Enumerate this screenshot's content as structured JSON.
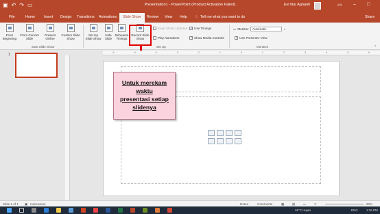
{
  "window": {
    "title": "Presentation1 - PowerPoint (Product Activation Failed)",
    "user": "Evi Nur Agnanti",
    "qat_icons": [
      "save-icon",
      "undo-icon",
      "redo-icon",
      "present-icon"
    ]
  },
  "menu": {
    "tabs": [
      "File",
      "Home",
      "Insert",
      "Design",
      "Transitions",
      "Animations",
      "Slide Show",
      "Review",
      "View",
      "Help"
    ],
    "active_tab": "Slide Show",
    "tell_me": "Tell me what you want to do",
    "share": "Share"
  },
  "ribbon": {
    "start_group": {
      "label": "Start Slide Show",
      "buttons": [
        "From Beginning",
        "From Current Slide",
        "Present Online",
        "Custom Slide Show"
      ]
    },
    "setup_group": {
      "label": "Set Up",
      "buttons": [
        "Set Up Slide Show",
        "Hide Slide",
        "Rehearse Timings",
        "Record Slide Show"
      ],
      "checks": [
        {
          "label": "Keep Slides Updated",
          "checked": false
        },
        {
          "label": "Use Timings",
          "checked": true
        },
        {
          "label": "Play Narrations",
          "checked": false
        },
        {
          "label": "Show Media Controls",
          "checked": true
        }
      ]
    },
    "monitors_group": {
      "label": "Monitors",
      "monitor_label": "Monitor:",
      "monitor_value": "Automatic",
      "presenter_view": {
        "label": "Use Presenter View",
        "checked": true
      }
    }
  },
  "thumbnails": {
    "slide_number": "1"
  },
  "annotation": {
    "line1": "Untuk merekam waktu",
    "line2": "presentasi setiap",
    "line3": "slidenya",
    "highlight_color": "#e00000"
  },
  "statusbar": {
    "slide_info": "Slide 1 of 1",
    "language": "Indonesian",
    "notes": "Notes",
    "comments": "Comments",
    "zoom": "60%"
  },
  "taskbar": {
    "weather": "26°C Hujan",
    "lang": "ENG",
    "time": "1:26 PM"
  }
}
